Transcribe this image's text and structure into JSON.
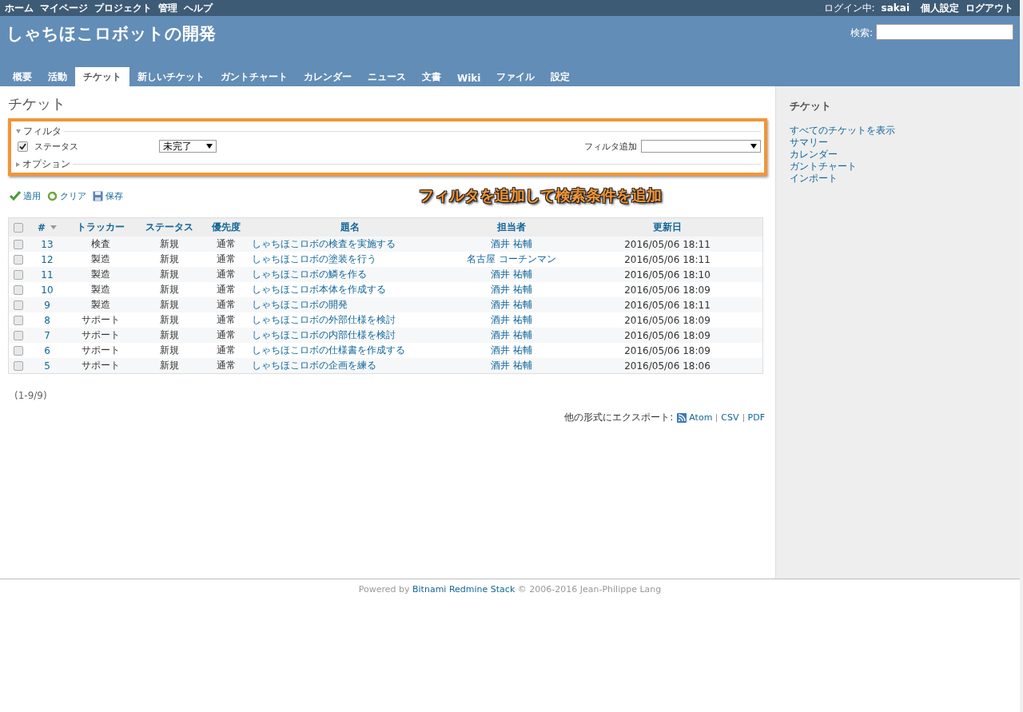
{
  "top_menu": {
    "items": [
      "ホーム",
      "マイページ",
      "プロジェクト",
      "管理",
      "ヘルプ"
    ],
    "logged_in_label": "ログイン中:",
    "user": "sakai",
    "account_links": [
      "個人設定",
      "ログアウト"
    ]
  },
  "header": {
    "title": "しゃちほこロボットの開発",
    "search_label": "検索:"
  },
  "tabs": [
    {
      "label": "概要",
      "selected": false
    },
    {
      "label": "活動",
      "selected": false
    },
    {
      "label": "チケット",
      "selected": true
    },
    {
      "label": "新しいチケット",
      "selected": false
    },
    {
      "label": "ガントチャート",
      "selected": false
    },
    {
      "label": "カレンダー",
      "selected": false
    },
    {
      "label": "ニュース",
      "selected": false
    },
    {
      "label": "文書",
      "selected": false
    },
    {
      "label": "Wiki",
      "selected": false
    },
    {
      "label": "ファイル",
      "selected": false
    },
    {
      "label": "設定",
      "selected": false
    }
  ],
  "page_title": "チケット",
  "filters": {
    "legend": "フィルタ",
    "expanded": true,
    "status_filter": {
      "label": "ステータス",
      "checked": true,
      "value": "未完了"
    },
    "add_filter_label": "フィルタ追加",
    "options_legend": "オプション",
    "options_expanded": false
  },
  "annotation": "フィルタを追加して検索条件を追加",
  "actions": [
    "適用",
    "クリア",
    "保存"
  ],
  "table": {
    "select_all_checked": false,
    "columns": [
      "#",
      "トラッカー",
      "ステータス",
      "優先度",
      "題名",
      "担当者",
      "更新日"
    ],
    "rows": [
      {
        "checked": false,
        "id": "13",
        "tracker": "検査",
        "status": "新規",
        "priority": "通常",
        "subject": "しゃちほこロボの検査を実施する",
        "assignee": "酒井 祐輔",
        "updated": "2016/05/06 18:11"
      },
      {
        "checked": false,
        "id": "12",
        "tracker": "製造",
        "status": "新規",
        "priority": "通常",
        "subject": "しゃちほこロボの塗装を行う",
        "assignee": "名古屋 コーチンマン",
        "updated": "2016/05/06 18:11"
      },
      {
        "checked": false,
        "id": "11",
        "tracker": "製造",
        "status": "新規",
        "priority": "通常",
        "subject": "しゃちほこロボの鱗を作る",
        "assignee": "酒井 祐輔",
        "updated": "2016/05/06 18:10"
      },
      {
        "checked": false,
        "id": "10",
        "tracker": "製造",
        "status": "新規",
        "priority": "通常",
        "subject": "しゃちほこロボ本体を作成する",
        "assignee": "酒井 祐輔",
        "updated": "2016/05/06 18:09"
      },
      {
        "checked": false,
        "id": "9",
        "tracker": "製造",
        "status": "新規",
        "priority": "通常",
        "subject": "しゃちほこロボの開発",
        "assignee": "酒井 祐輔",
        "updated": "2016/05/06 18:11"
      },
      {
        "checked": false,
        "id": "8",
        "tracker": "サポート",
        "status": "新規",
        "priority": "通常",
        "subject": "しゃちほこロボの外部仕様を検討",
        "assignee": "酒井 祐輔",
        "updated": "2016/05/06 18:09"
      },
      {
        "checked": false,
        "id": "7",
        "tracker": "サポート",
        "status": "新規",
        "priority": "通常",
        "subject": "しゃちほこロボの内部仕様を検討",
        "assignee": "酒井 祐輔",
        "updated": "2016/05/06 18:09"
      },
      {
        "checked": false,
        "id": "6",
        "tracker": "サポート",
        "status": "新規",
        "priority": "通常",
        "subject": "しゃちほこロボの仕様書を作成する",
        "assignee": "酒井 祐輔",
        "updated": "2016/05/06 18:09"
      },
      {
        "checked": false,
        "id": "5",
        "tracker": "サポート",
        "status": "新規",
        "priority": "通常",
        "subject": "しゃちほこロボの企画を練る",
        "assignee": "酒井 祐輔",
        "updated": "2016/05/06 18:06"
      }
    ]
  },
  "pagination": "(1-9/9)",
  "export": {
    "label": "他の形式にエクスポート:",
    "links": [
      "Atom",
      "CSV",
      "PDF"
    ]
  },
  "sidebar": {
    "title": "チケット",
    "links": [
      "すべてのチケットを表示",
      "サマリー",
      "カレンダー",
      "ガントチャート",
      "インポート"
    ]
  },
  "footer": {
    "prefix": "Powered by",
    "link": "Bitnami Redmine Stack",
    "suffix": "© 2006-2016 Jean-Philippe Lang"
  }
}
